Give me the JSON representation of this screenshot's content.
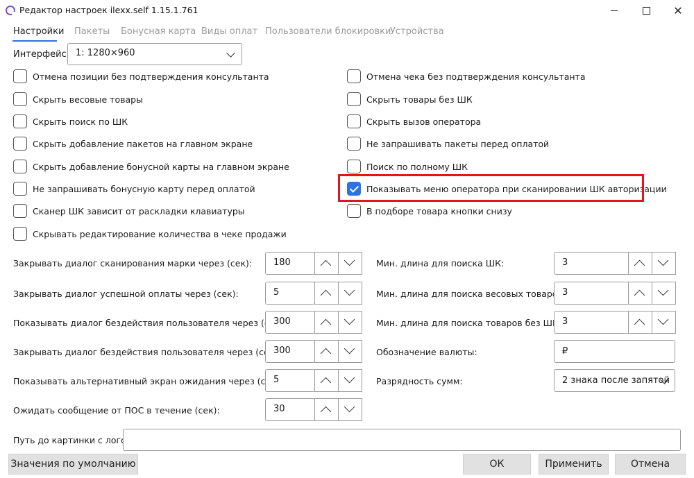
{
  "window": {
    "title": "Редактор настроек ilexx.self 1.15.1.761"
  },
  "tabs": [
    {
      "label": "Настройки",
      "active": true
    },
    {
      "label": "Пакеты",
      "active": false
    },
    {
      "label": "Бонусная карта",
      "active": false
    },
    {
      "label": "Виды оплат",
      "active": false
    },
    {
      "label": "Пользователи блокировки",
      "active": false
    },
    {
      "label": "Устройства",
      "active": false
    }
  ],
  "interface": {
    "label": "Интерфейс:",
    "value": "1: 1280×960"
  },
  "checkboxes_left": [
    {
      "label": "Отмена позиции без подтверждения консультанта",
      "checked": false
    },
    {
      "label": "Скрыть весовые товары",
      "checked": false
    },
    {
      "label": "Скрыть поиск по ШК",
      "checked": false
    },
    {
      "label": "Скрыть добавление пакетов на главном экране",
      "checked": false
    },
    {
      "label": "Скрыть добавление бонусной карты на главном экране",
      "checked": false
    },
    {
      "label": "Не запрашивать бонусную карту перед оплатой",
      "checked": false
    },
    {
      "label": "Сканер ШК зависит от раскладки клавиатуры",
      "checked": false
    },
    {
      "label": "Скрывать редактирование количества в чеке продажи",
      "checked": false
    }
  ],
  "checkboxes_right": [
    {
      "label": "Отмена чека без подтверждения консультанта",
      "checked": false
    },
    {
      "label": "Скрыть товары без ШК",
      "checked": false
    },
    {
      "label": "Скрыть вызов оператора",
      "checked": false
    },
    {
      "label": "Не запрашивать пакеты перед оплатой",
      "checked": false
    },
    {
      "label": "Поиск по полному ШК",
      "checked": false
    },
    {
      "label": "Показывать меню оператора при сканировании ШК авторизации",
      "checked": true
    },
    {
      "label": "В подборе товара кнопки снизу",
      "checked": false
    }
  ],
  "fields_left": [
    {
      "label": "Закрывать диалог сканирования марки через (сек):",
      "value": "180"
    },
    {
      "label": "Закрывать диалог успешной оплаты через (сек):",
      "value": "5"
    },
    {
      "label": "Показывать диалог бездействия пользователя через (сек):",
      "value": "300"
    },
    {
      "label": "Закрывать диалог бездействия пользователя через (сек):",
      "value": "300"
    },
    {
      "label": "Показывать альтернативный экран ожидания через (сек):",
      "value": "5"
    },
    {
      "label": "Ожидать сообщение от ПОС в течение (сек):",
      "value": "30"
    }
  ],
  "fields_right": [
    {
      "label": "Мин. длина для поиска ШК:",
      "value": "3"
    },
    {
      "label": "Мин. длина для поиска весовых товаров:",
      "value": "3"
    },
    {
      "label": "Мин. длина для поиска товаров без ШК:",
      "value": "3"
    }
  ],
  "currency": {
    "label": "Обозначение валюты:",
    "value": "₽"
  },
  "digits": {
    "label": "Разрядность сумм:",
    "value": "2 знака после запятой"
  },
  "logo_path": {
    "label": "Путь до картинки с лого:",
    "value": ""
  },
  "buttons": {
    "defaults": "Значения по умолчанию",
    "ok": "ОК",
    "apply": "Применить",
    "cancel": "Отмена"
  },
  "colors": {
    "accent": "#2a72e6",
    "highlight": "#e3141b"
  },
  "icons": {
    "app": "app-logo-icon",
    "minimize": "minimize-icon",
    "maximize": "maximize-icon",
    "close": "close-icon",
    "dropdown": "chevron-down-icon",
    "spin_up": "chevron-up-icon",
    "spin_down": "chevron-down-icon",
    "check": "checkmark-icon"
  }
}
